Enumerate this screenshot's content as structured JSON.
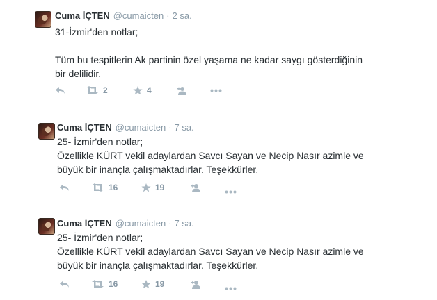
{
  "tweets": [
    {
      "name": "Cuma İÇTEN",
      "handle": "@cumaicten",
      "time": "2 sa.",
      "text": "31-İzmir'den notlar;\n\nTüm bu tespitlerin Ak partinin özel yaşama ne kadar saygı gösterdiğinin\nbir delilidir.",
      "retweets": "2",
      "likes": "4"
    },
    {
      "name": "Cuma İÇTEN",
      "handle": "@cumaicten",
      "time": "7 sa.",
      "text": "25- İzmir'den notlar;\nÖzellikle KÜRT vekil adaylardan Savcı Sayan ve Necip Nasır azimle ve\nbüyük bir inançla çalışmaktadırlar. Teşekkürler.",
      "retweets": "16",
      "likes": "19"
    },
    {
      "name": "Cuma İÇTEN",
      "handle": "@cumaicten",
      "time": "7 sa.",
      "text": "25- İzmir'den notlar;\nÖzellikle KÜRT vekil adaylardan Savcı Sayan ve Necip Nasır azimle ve\nbüyük bir inançla çalışmaktadırlar. Teşekkürler.",
      "retweets": "16",
      "likes": "19"
    }
  ],
  "icons": {
    "reply": "reply-icon",
    "retweet": "retweet-icon",
    "like": "star-icon",
    "follow": "follow-icon",
    "more": "more-icon"
  },
  "colors": {
    "icon": "#aab8c2",
    "meta": "#8899a6",
    "text": "#292f33"
  }
}
